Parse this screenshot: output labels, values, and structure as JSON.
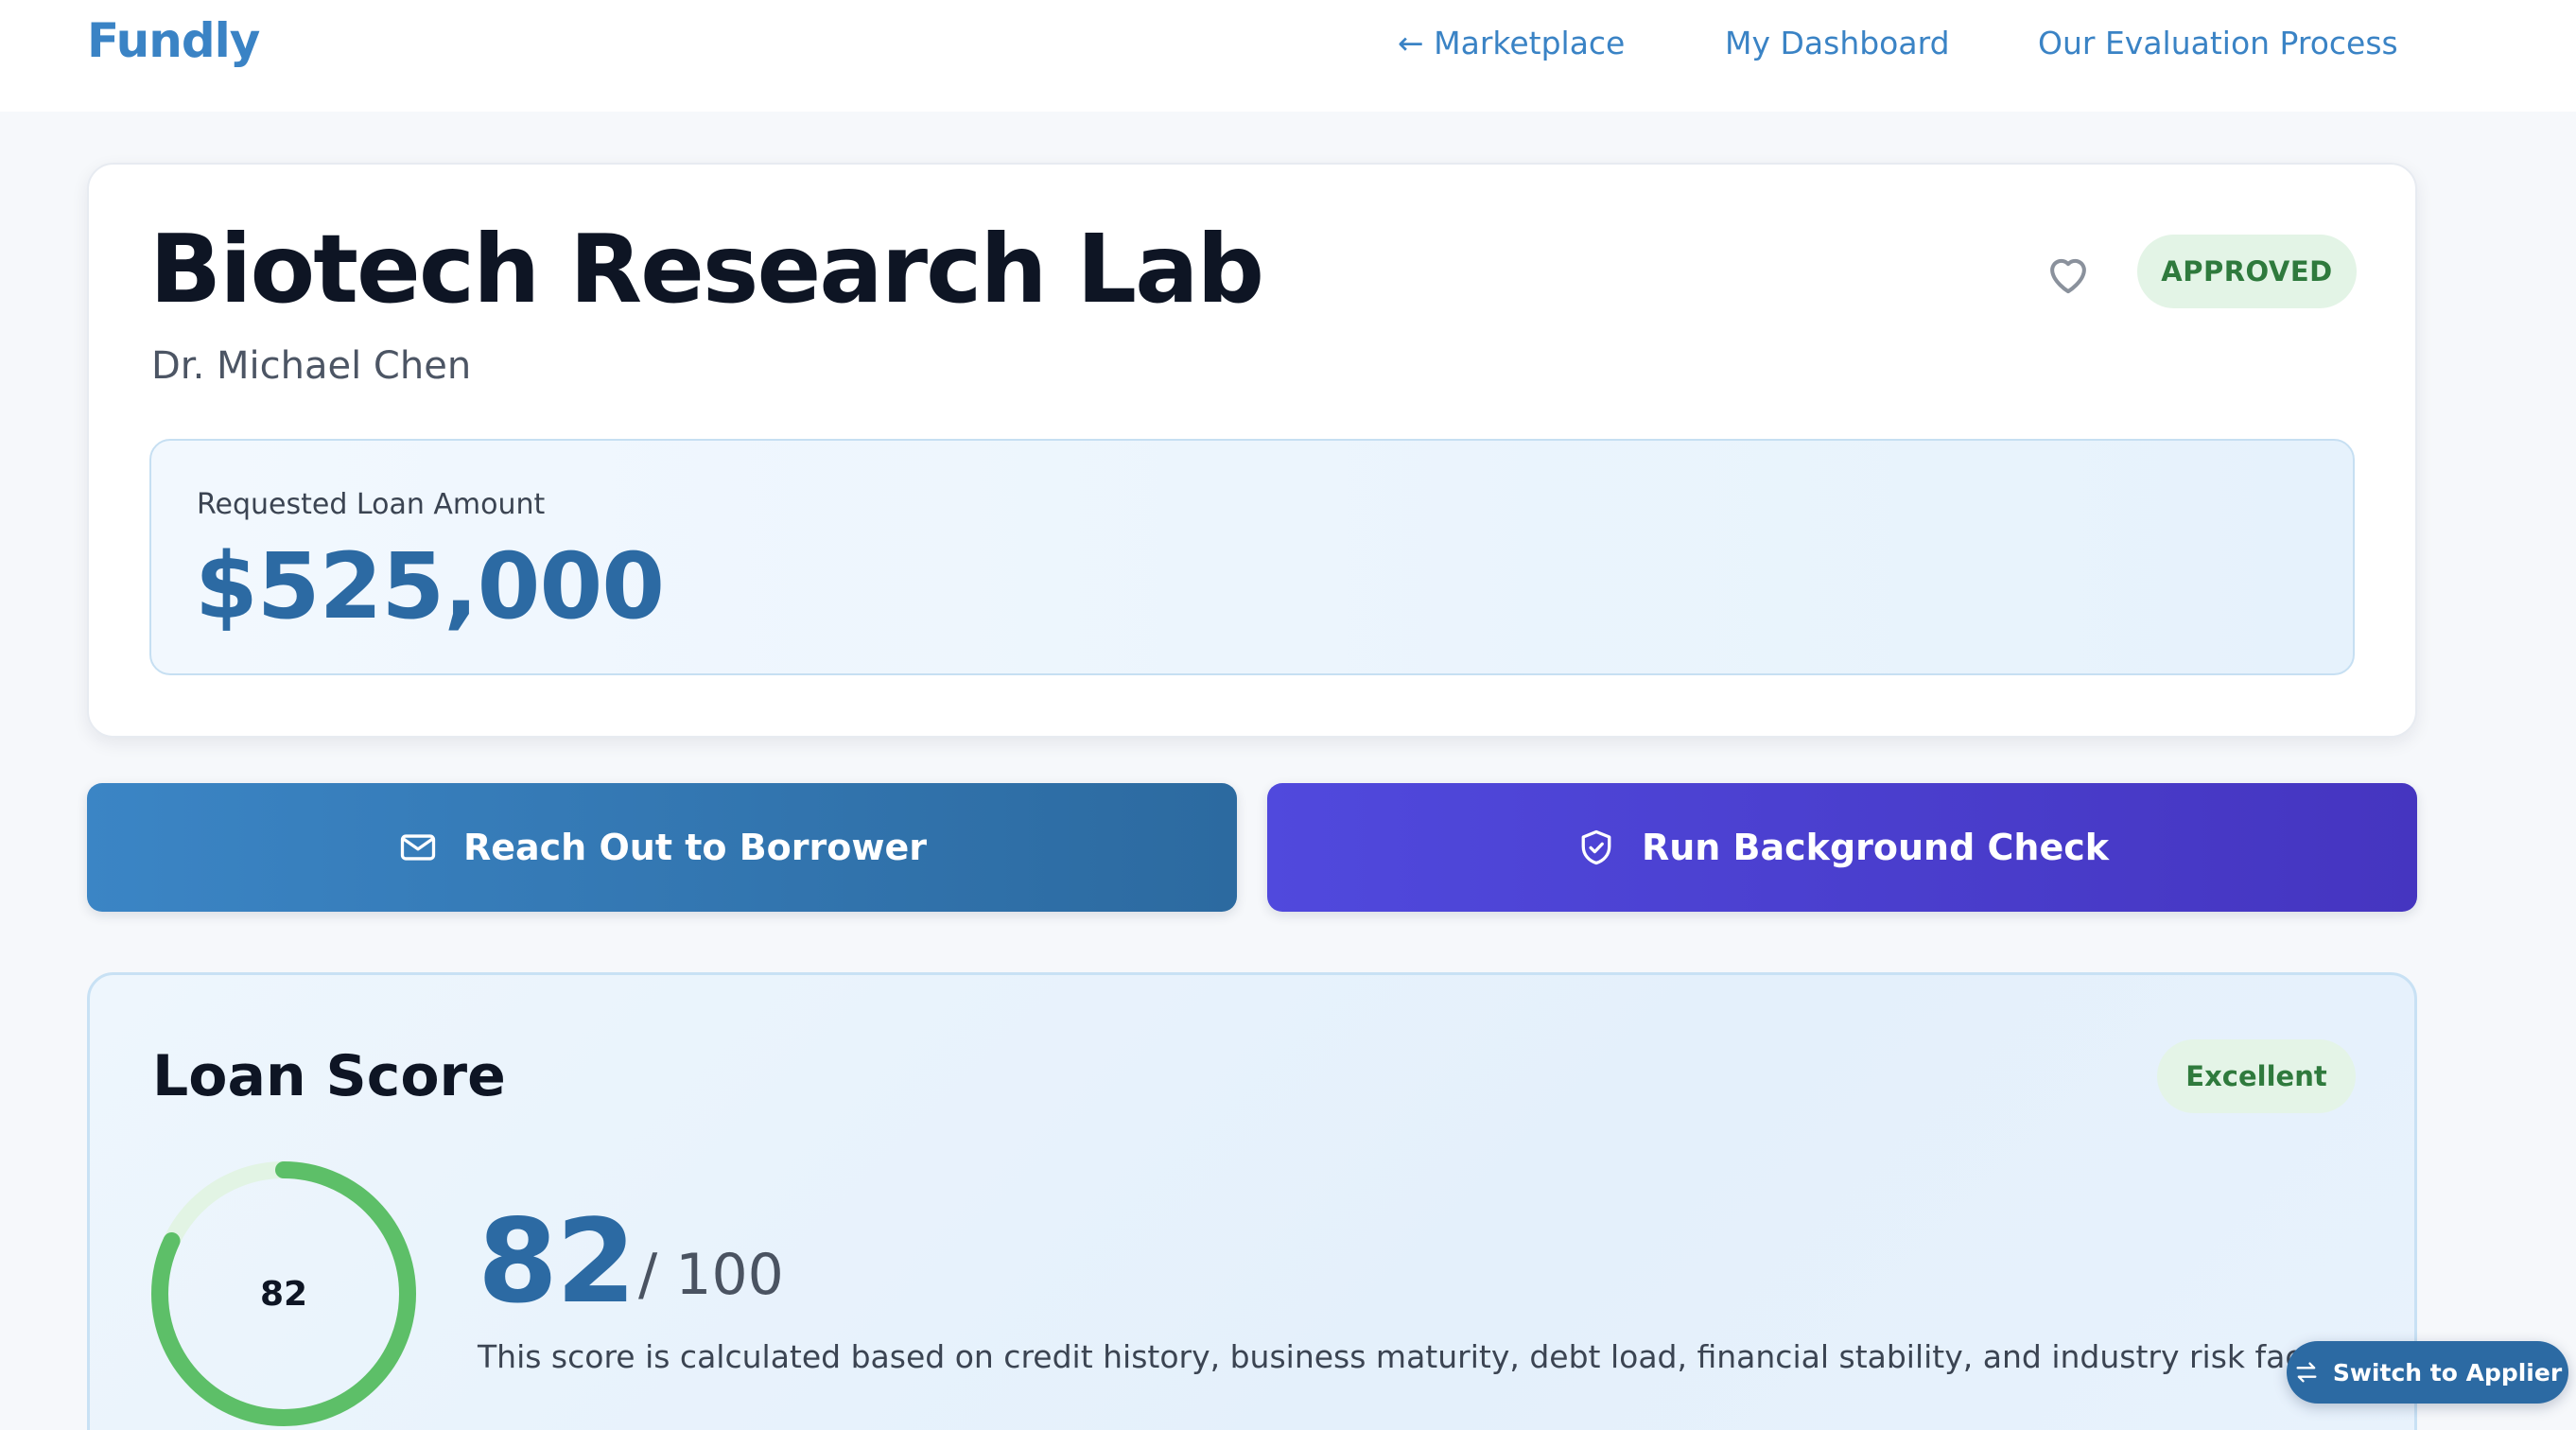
{
  "header": {
    "brand": "Fundly",
    "nav": {
      "marketplace": "← Marketplace",
      "dashboard": "My Dashboard",
      "process": "Our Evaluation Process"
    }
  },
  "listing": {
    "title": "Biotech Research Lab",
    "owner": "Dr. Michael Chen",
    "status": "APPROVED",
    "favorite_icon": "heart-icon",
    "amount_label": "Requested Loan Amount",
    "amount_value": "$525,000"
  },
  "actions": {
    "reach_out": "Reach Out to Borrower",
    "reach_out_icon": "mail-icon",
    "background_check": "Run Background Check",
    "background_check_icon": "shield-check-icon"
  },
  "score": {
    "title": "Loan Score",
    "rating": "Excellent",
    "value": 82,
    "value_text": "82",
    "max_text": "/ 100",
    "gauge_label": "82",
    "gauge_fraction": 0.82,
    "description": "This score is calculated based on credit history, business maturity, debt load, financial stability, and industry risk factors."
  },
  "switch": {
    "label": "Switch to Applier",
    "icon": "swap-arrows-icon"
  },
  "colors": {
    "brand": "#3a83c5",
    "primary_dark": "#2c6aa3",
    "indigo": "#4a40d0",
    "success_text": "#2f7a3d",
    "success_bg": "#e3f4e6",
    "gauge_fill": "#5dbf68",
    "gauge_track": "#e2f4e4"
  }
}
